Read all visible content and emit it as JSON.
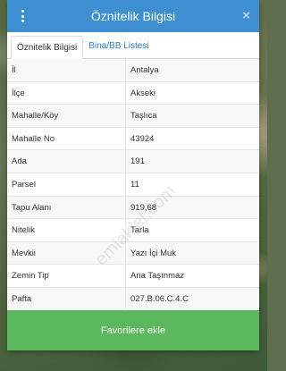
{
  "header": {
    "title": "Öznitelik Bilgisi",
    "close": "×"
  },
  "tabs": [
    {
      "label": "Öznitelik Bilgisi",
      "active": true
    },
    {
      "label": "Bina/BB Listesi",
      "active": false
    }
  ],
  "rows": [
    {
      "key": "İl",
      "value": "Antalya"
    },
    {
      "key": "İlçe",
      "value": "Akseki"
    },
    {
      "key": "Mahalle/Köy",
      "value": "Taşlıca"
    },
    {
      "key": "Mahalle No",
      "value": "43924"
    },
    {
      "key": "Ada",
      "value": "191"
    },
    {
      "key": "Parsel",
      "value": "11"
    },
    {
      "key": "Tapu Alanı",
      "value": "919,68"
    },
    {
      "key": "Nitelik",
      "value": "Tarla"
    },
    {
      "key": "Mevkii",
      "value": "Yazı İçi Muk"
    },
    {
      "key": "Zemin Tip",
      "value": "Ana Taşınmaz"
    },
    {
      "key": "Pafta",
      "value": "027.B.06.C.4.C"
    }
  ],
  "watermark": "emlakjet.com",
  "footer": {
    "button_label": "Favorilere ekle"
  },
  "colors": {
    "header": "#3d8fd1",
    "button": "#5cb85c",
    "tab_link": "#2a7fc4"
  }
}
